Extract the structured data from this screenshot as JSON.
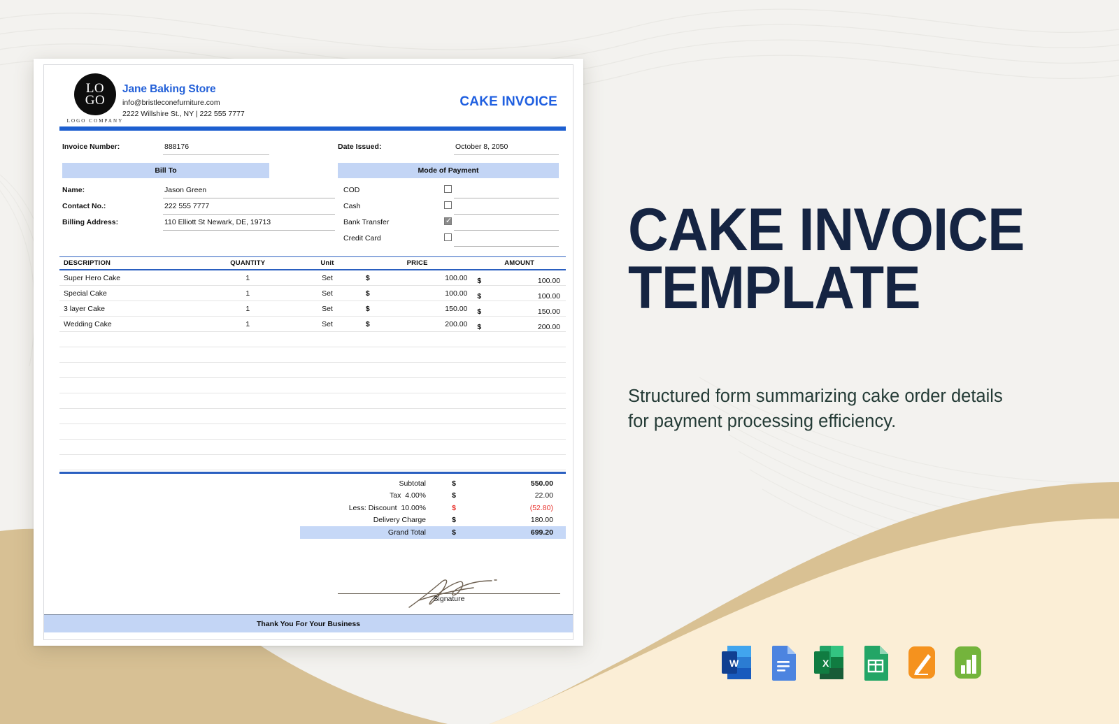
{
  "background": {
    "base_color": "#f2f1ee",
    "wave_tan": "#d5bd8e",
    "wave_cream": "#fbeed6"
  },
  "invoice": {
    "company": {
      "logo_text_top": "LO",
      "logo_text_bottom": "GO",
      "logo_caption": "LOGO COMPANY",
      "name": "Jane Baking Store",
      "email": "info@bristleconefurniture.com",
      "address": "2222 Willshire St., NY | 222 555 7777"
    },
    "doc_title": "CAKE INVOICE",
    "meta": {
      "invoice_number_label": "Invoice Number:",
      "invoice_number_value": "888176",
      "date_issued_label": "Date Issued:",
      "date_issued_value": "October 8, 2050"
    },
    "bill_to": {
      "band_title": "Bill To",
      "rows": [
        {
          "label": "Name:",
          "value": "Jason Green"
        },
        {
          "label": "Contact No.:",
          "value": "222 555 7777"
        },
        {
          "label": "Billing Address:",
          "value": "110 Elliott St Newark, DE, 19713"
        }
      ]
    },
    "payment": {
      "band_title": "Mode of Payment",
      "options": [
        {
          "label": "COD",
          "checked": false
        },
        {
          "label": "Cash",
          "checked": false
        },
        {
          "label": "Bank Transfer",
          "checked": true
        },
        {
          "label": "Credit Card",
          "checked": false
        }
      ]
    },
    "items_table": {
      "headers": [
        "DESCRIPTION",
        "QUANTITY",
        "Unit",
        "PRICE",
        "AMOUNT"
      ],
      "currency": "$",
      "rows": [
        {
          "description": "Super Hero Cake",
          "quantity": "1",
          "unit": "Set",
          "price": "100.00",
          "amount": "100.00"
        },
        {
          "description": "Special Cake",
          "quantity": "1",
          "unit": "Set",
          "price": "100.00",
          "amount": "100.00"
        },
        {
          "description": "3 layer Cake",
          "quantity": "1",
          "unit": "Set",
          "price": "150.00",
          "amount": "150.00"
        },
        {
          "description": "Wedding Cake",
          "quantity": "1",
          "unit": "Set",
          "price": "200.00",
          "amount": "200.00"
        }
      ],
      "blank_row_count": 9
    },
    "totals": [
      {
        "label": "Subtotal",
        "rate": "",
        "currency": "$",
        "amount": "550.00",
        "style": "bold"
      },
      {
        "label": "Tax",
        "rate": "4.00%",
        "currency": "$",
        "amount": "22.00",
        "style": "normal"
      },
      {
        "label": "Less: Discount",
        "rate": "10.00%",
        "currency": "$",
        "amount": "(52.80)",
        "style": "negative"
      },
      {
        "label": "Delivery Charge",
        "rate": "",
        "currency": "$",
        "amount": "180.00",
        "style": "normal"
      },
      {
        "label": "Grand Total",
        "rate": "",
        "currency": "$",
        "amount": "699.20",
        "style": "grand"
      }
    ],
    "signature_label": "Signature",
    "footer_text": "Thank You For Your Business"
  },
  "promo": {
    "title_line1": "CAKE INVOICE",
    "title_line2": "TEMPLATE",
    "subtitle": "Structured form summarizing cake order details for payment processing efficiency.",
    "title_color": "#152442",
    "apps": [
      {
        "name": "microsoft-word",
        "label": "W"
      },
      {
        "name": "google-docs",
        "label": ""
      },
      {
        "name": "microsoft-excel",
        "label": "X"
      },
      {
        "name": "google-sheets",
        "label": ""
      },
      {
        "name": "apple-pages",
        "label": ""
      },
      {
        "name": "apple-numbers",
        "label": ""
      }
    ]
  }
}
